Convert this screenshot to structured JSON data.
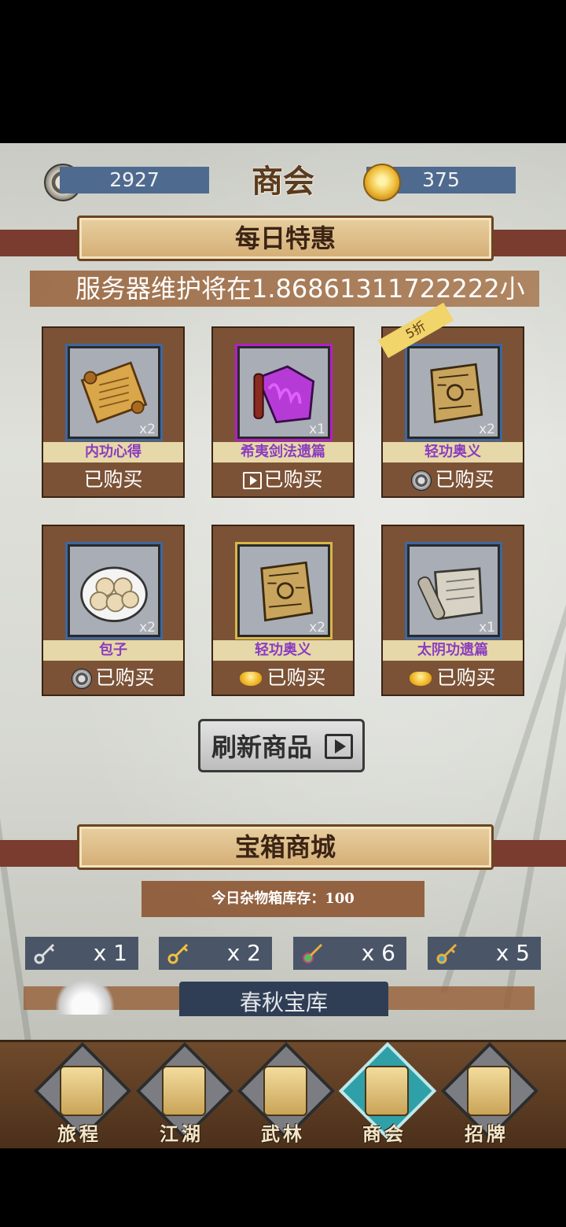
{
  "header": {
    "title": "商会",
    "copper_value": "2927",
    "gold_value": "375"
  },
  "daily_special": {
    "title": "每日特惠",
    "notice": "服务器维护将在1.86861311722222小",
    "items": [
      {
        "name": "内功心得",
        "qty": "x2",
        "action": "已购买",
        "currency": "none",
        "icon": "scroll-icon"
      },
      {
        "name": "希夷剑法遗篇",
        "qty": "x1",
        "action": "已购买",
        "currency": "video",
        "icon": "purple-manual-icon"
      },
      {
        "name": "轻功奥义",
        "qty": "x2",
        "action": "已购买",
        "currency": "copper",
        "icon": "parchment-icon",
        "badge": "5折"
      },
      {
        "name": "包子",
        "qty": "x2",
        "action": "已购买",
        "currency": "copper",
        "icon": "buns-icon"
      },
      {
        "name": "轻功奥义",
        "qty": "x2",
        "action": "已购买",
        "currency": "gold",
        "icon": "parchment-icon"
      },
      {
        "name": "太阴功遗篇",
        "qty": "x1",
        "action": "已购买",
        "currency": "gold",
        "icon": "old-scroll-icon"
      }
    ],
    "refresh_label": "刷新商品"
  },
  "chest_shop": {
    "title": "宝箱商城",
    "stock_text": "今日杂物箱库存：100",
    "keys": [
      {
        "icon": "silver-key-icon",
        "count": "x 1"
      },
      {
        "icon": "gold-key-icon",
        "count": "x 2"
      },
      {
        "icon": "jade-key-icon",
        "count": "x 6"
      },
      {
        "icon": "ornate-key-icon",
        "count": "x 5"
      }
    ],
    "treasury_tab": "春秋宝库"
  },
  "nav": {
    "items": [
      {
        "label": "旅程",
        "icon": "traveler-icon",
        "active": false
      },
      {
        "label": "江湖",
        "icon": "gate-icon",
        "active": false
      },
      {
        "label": "武林",
        "icon": "crossed-swords-icon",
        "active": false
      },
      {
        "label": "商会",
        "icon": "pavilion-icon",
        "active": true
      },
      {
        "label": "招牌",
        "icon": "sign-card-icon",
        "active": false
      }
    ]
  },
  "colors": {
    "band": "#7a3c2f",
    "card_bg": "#7b5236",
    "name_text": "#8a3cc0",
    "currency_box": "#4e6a8f",
    "active_nav": "#30a0a8"
  }
}
